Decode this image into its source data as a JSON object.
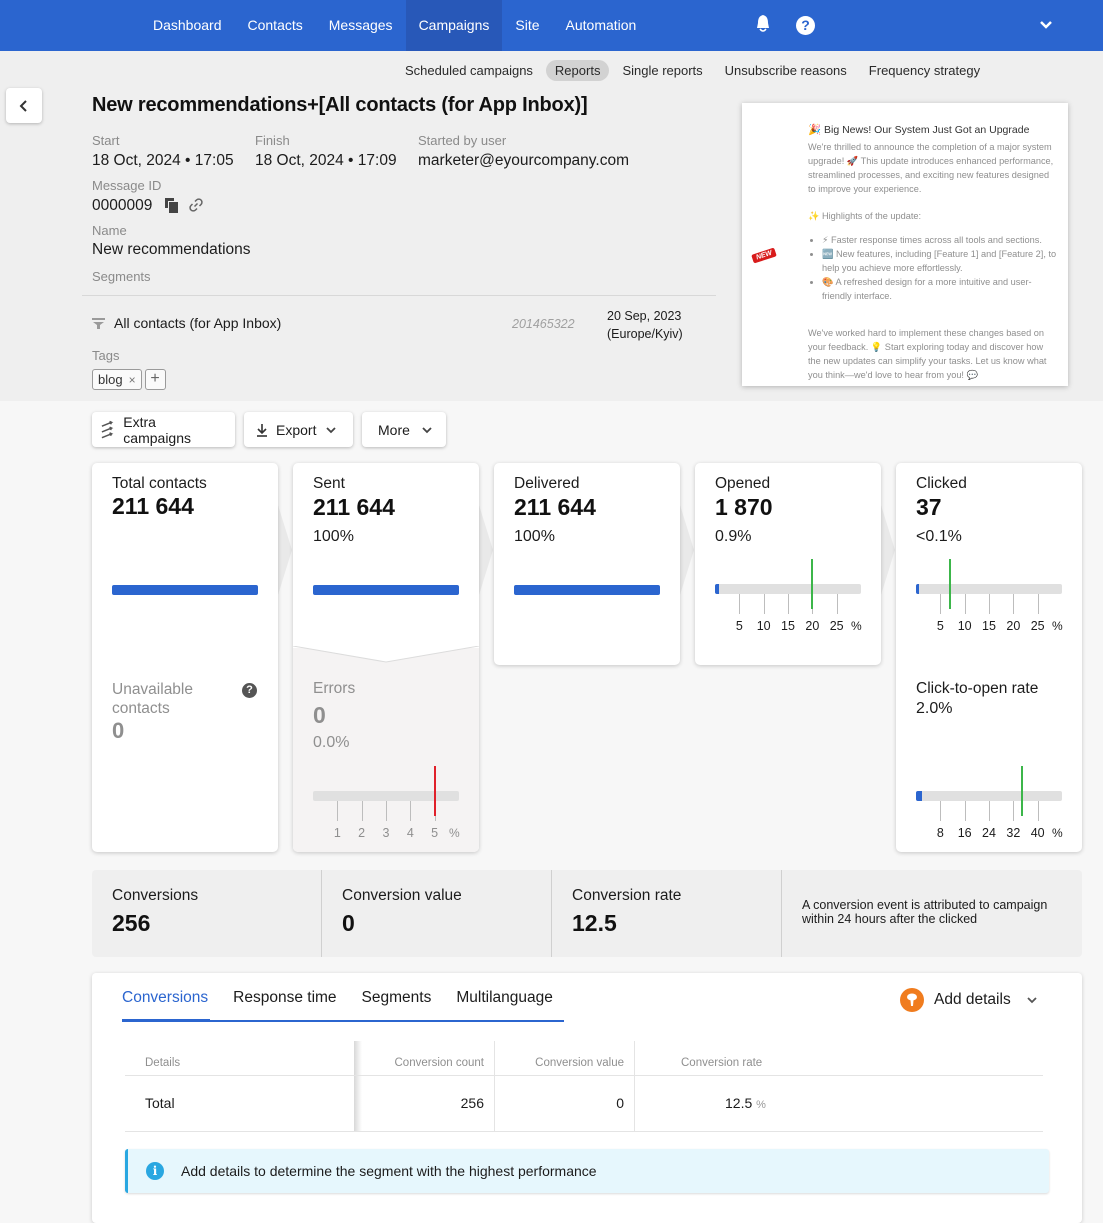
{
  "topnav": {
    "items": [
      {
        "label": "Dashboard",
        "active": false
      },
      {
        "label": "Contacts",
        "active": false
      },
      {
        "label": "Messages",
        "active": false
      },
      {
        "label": "Campaigns",
        "active": true
      },
      {
        "label": "Site",
        "active": false
      },
      {
        "label": "Automation",
        "active": false
      }
    ],
    "icons": [
      "bell-icon",
      "help-icon",
      "chevron-down-icon"
    ],
    "help_glyph": "?"
  },
  "subnav": {
    "items": [
      {
        "label": "Scheduled campaigns",
        "active": false
      },
      {
        "label": "Reports",
        "active": true
      },
      {
        "label": "Single reports",
        "active": false
      },
      {
        "label": "Unsubscribe reasons",
        "active": false
      },
      {
        "label": "Frequency strategy",
        "active": false
      }
    ]
  },
  "header": {
    "title": "New recommendations+[All contacts (for App Inbox)]",
    "start_label": "Start",
    "start_value": "18 Oct, 2024 • 17:05",
    "finish_label": "Finish",
    "finish_value": "18 Oct, 2024 • 17:09",
    "started_by_label": "Started by user",
    "started_by_value": "marketer@eyourcompany.com",
    "message_id_label": "Message ID",
    "message_id_value": "0000009",
    "name_label": "Name",
    "name_value": "New recommendations",
    "segments_label": "Segments",
    "segment": {
      "name": "All contacts (for App Inbox)",
      "count": "201465322",
      "date_line1": "20 Sep, 2023",
      "date_line2": "(Europe/Kyiv)"
    },
    "tags_label": "Tags",
    "tags": [
      "blog"
    ],
    "tag_remove_glyph": "×",
    "tag_add_glyph": "+"
  },
  "preview": {
    "title": "🎉 Big News! Our System Just Got an Upgrade",
    "intro": "We're thrilled to announce the completion of a major system upgrade! 🚀 This update introduces enhanced performance, streamlined processes, and exciting new features designed to improve your experience.",
    "highlights_heading": "✨ Highlights of the update:",
    "bullets": [
      "⚡ Faster response times across all tools and sections.",
      "🆕 New features, including [Feature 1] and [Feature 2], to help you achieve more effortlessly.",
      "🎨 A refreshed design for a more intuitive and user-friendly interface."
    ],
    "outro": "We've worked hard to implement these changes based on your feedback. 💡 Start exploring today and discover how the new updates can simplify your tasks. Let us know what you think—we'd love to hear from you! 💬",
    "badge": "NEW"
  },
  "actions": {
    "extra_campaigns": "Extra campaigns",
    "export": "Export",
    "more": "More"
  },
  "stats": {
    "total_contacts": {
      "label": "Total contacts",
      "value": "211 644",
      "progress": 1.0
    },
    "sent": {
      "label": "Sent",
      "value": "211 644",
      "percent": "100%",
      "progress": 1.0
    },
    "delivered": {
      "label": "Delivered",
      "value": "211 644",
      "percent": "100%",
      "progress": 1.0
    },
    "opened": {
      "label": "Opened",
      "value": "1 870",
      "percent": "0.9%",
      "rate": 0.9,
      "benchmark": 20,
      "scale_max": 30,
      "ticks": [
        "5",
        "10",
        "15",
        "20",
        "25"
      ],
      "unit": "%"
    },
    "clicked": {
      "label": "Clicked",
      "value": "37",
      "percent": "<0.1%",
      "rate": 0.02,
      "benchmark": 7,
      "scale_max": 30,
      "ticks": [
        "5",
        "10",
        "15",
        "20",
        "25"
      ],
      "unit": "%"
    },
    "unavailable": {
      "label": "Unavailable contacts",
      "value": "0"
    },
    "errors": {
      "label": "Errors",
      "value": "0",
      "percent": "0.0%",
      "rate": 0,
      "benchmark": 5,
      "scale_max": 6,
      "ticks": [
        "1",
        "2",
        "3",
        "4",
        "5"
      ],
      "unit": "%"
    },
    "cto": {
      "label": "Click-to-open rate",
      "percent": "2.0%",
      "rate": 2.0,
      "benchmark": 35,
      "scale_max": 48,
      "ticks": [
        "8",
        "16",
        "24",
        "32",
        "40"
      ],
      "unit": "%"
    }
  },
  "colors": {
    "brand": "#2b65cf",
    "benchmark_good": "#3cb64a",
    "benchmark_bad": "#e0202a",
    "info": "#29a7e1",
    "add_details": "#f07c1e"
  },
  "conversions": {
    "cells": [
      {
        "label": "Conversions",
        "value": "256"
      },
      {
        "label": "Conversion value",
        "value": "0"
      },
      {
        "label": "Conversion rate",
        "value": "12.5"
      }
    ],
    "note": "A conversion event is attributed to campaign within 24 hours after the clicked"
  },
  "details": {
    "tabs": [
      {
        "label": "Conversions",
        "active": true
      },
      {
        "label": "Response time",
        "active": false
      },
      {
        "label": "Segments",
        "active": false
      },
      {
        "label": "Multilanguage",
        "active": false
      }
    ],
    "add_details": "Add details",
    "table": {
      "headers": [
        "Details",
        "Conversion count",
        "Conversion value",
        "Conversion rate"
      ],
      "rows": [
        {
          "details": "Total",
          "count": "256",
          "value": "0",
          "rate": "12.5",
          "rate_unit": "%"
        }
      ]
    },
    "info": "Add details to determine the segment with the highest performance",
    "info_glyph": "i"
  }
}
